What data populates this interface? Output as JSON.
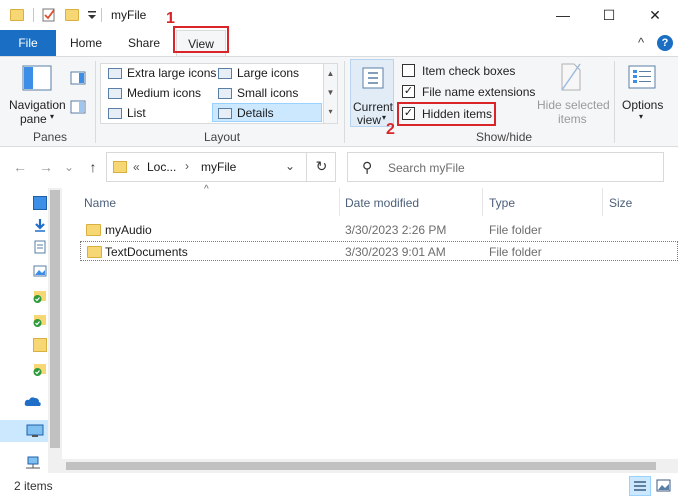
{
  "window": {
    "title": "myFile",
    "minimize_glyph": "—",
    "maximize_glyph": "☐",
    "close_glyph": "✕"
  },
  "ribbon_tabs": {
    "file": "File",
    "home": "Home",
    "share": "Share",
    "view": "View",
    "collapse_glyph": "^",
    "help_glyph": "?"
  },
  "callouts": {
    "first": "1",
    "second": "2"
  },
  "panes_group": {
    "nav_pane_line1": "Navigation",
    "nav_pane_line2": "pane",
    "label": "Panes"
  },
  "layout_group": {
    "label": "Layout",
    "items": [
      "Extra large icons",
      "Large icons",
      "Medium icons",
      "Small icons",
      "List",
      "Details"
    ],
    "selected": "Details"
  },
  "current_view_group": {
    "line1": "Current",
    "line2": "view"
  },
  "show_hide_group": {
    "label": "Show/hide",
    "item_check_boxes": {
      "label": "Item check boxes",
      "checked": false
    },
    "file_name_extensions": {
      "label": "File name extensions",
      "checked": true
    },
    "hidden_items": {
      "label": "Hidden items",
      "checked": true
    },
    "hide_selected_line1": "Hide selected",
    "hide_selected_line2": "items",
    "check_glyph": "✓"
  },
  "options_group": {
    "label": "Options"
  },
  "address": {
    "prefix": "«",
    "crumb_parent": "Loc...",
    "separator": "›",
    "crumb_current": "myFile",
    "back_glyph": "←",
    "forward_glyph": "→",
    "recent_glyph": "⌄",
    "up_glyph": "↑",
    "dropdown_glyph": "⌄",
    "refresh_glyph": "↻"
  },
  "search": {
    "placeholder": "Search myFile",
    "icon_glyph": "⚲"
  },
  "columns": {
    "name": "Name",
    "date": "Date modified",
    "type": "Type",
    "size": "Size",
    "sort_glyph": "^"
  },
  "files": [
    {
      "name": "myAudio",
      "date": "3/30/2023 2:26 PM",
      "type": "File folder"
    },
    {
      "name": "TextDocuments",
      "date": "3/30/2023 9:01 AM",
      "type": "File folder"
    }
  ],
  "status": {
    "count": "2 items"
  },
  "colors": {
    "accent": "#1a6fc4",
    "callout": "#d9252a",
    "folder": "#f7d674"
  }
}
